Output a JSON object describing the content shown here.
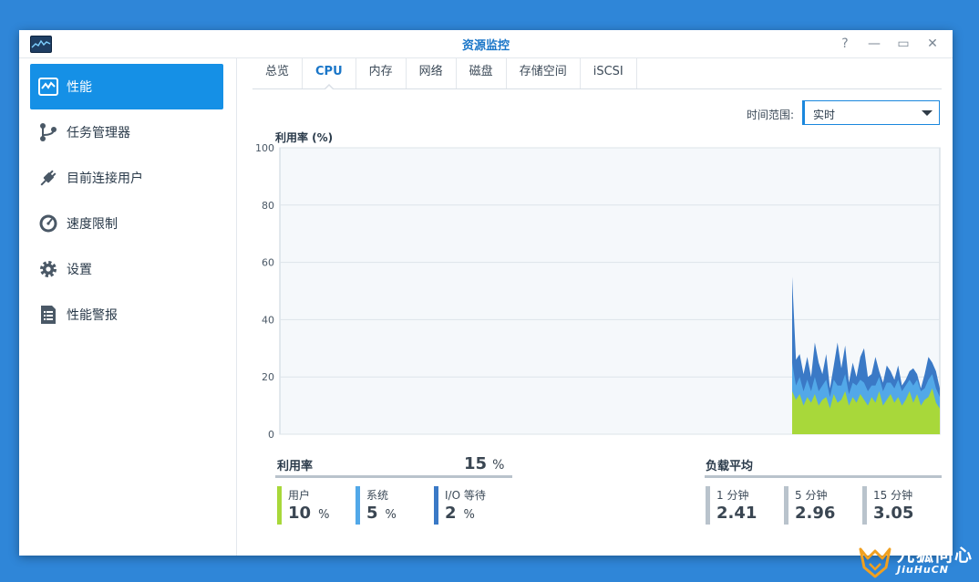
{
  "window": {
    "title": "资源监控"
  },
  "window_controls": [
    "?",
    "—",
    "▭",
    "✕"
  ],
  "sidebar": {
    "items": [
      {
        "label": "性能",
        "icon": "performance-icon",
        "active": true
      },
      {
        "label": "任务管理器",
        "icon": "task-manager-icon"
      },
      {
        "label": "目前连接用户",
        "icon": "plug-icon"
      },
      {
        "label": "速度限制",
        "icon": "speedometer-icon"
      },
      {
        "label": "设置",
        "icon": "gear-icon"
      },
      {
        "label": "性能警报",
        "icon": "report-icon"
      }
    ]
  },
  "tabs": [
    "总览",
    "CPU",
    "内存",
    "网络",
    "磁盘",
    "存储空间",
    "iSCSI"
  ],
  "active_tab": "CPU",
  "time_range": {
    "label": "时间范围:",
    "value": "实时"
  },
  "chart_data": {
    "type": "area",
    "title": "利用率 (%)",
    "ylim": [
      0,
      100
    ],
    "y_ticks": [
      "100",
      "80",
      "60",
      "40",
      "20",
      "0"
    ],
    "grid": true,
    "stacked": true,
    "colors": {
      "user": "#a8d83a",
      "system": "#52a8e8",
      "io": "#3a79c6"
    },
    "series": [
      {
        "name": "用户",
        "values": [
          15,
          12,
          14,
          10,
          13,
          11,
          14,
          10,
          12,
          13,
          9,
          14,
          11,
          12,
          15,
          10,
          13,
          11,
          14,
          12,
          10,
          13,
          11,
          15,
          10,
          12,
          14,
          11,
          13,
          10,
          12,
          15,
          11,
          14,
          10,
          12,
          13,
          16,
          11,
          9
        ]
      },
      {
        "name": "系统",
        "values": [
          10,
          5,
          6,
          5,
          6,
          4,
          6,
          5,
          5,
          6,
          4,
          5,
          6,
          5,
          6,
          4,
          5,
          6,
          5,
          6,
          5,
          4,
          6,
          5,
          5,
          6,
          4,
          5,
          6,
          5,
          5,
          4,
          6,
          5,
          5,
          4,
          6,
          5,
          5,
          4
        ]
      },
      {
        "name": "I/O 等待",
        "values": [
          30,
          9,
          8,
          6,
          8,
          5,
          12,
          10,
          4,
          9,
          3,
          5,
          15,
          6,
          10,
          4,
          7,
          3,
          8,
          12,
          5,
          4,
          10,
          2,
          3,
          6,
          4,
          3,
          5,
          2,
          2,
          3,
          6,
          2,
          1,
          5,
          8,
          4,
          6,
          3
        ]
      }
    ]
  },
  "utilization": {
    "label": "利用率",
    "value": "15",
    "unit": "%"
  },
  "breakdown": [
    {
      "label": "用户",
      "value": "10",
      "unit": "%",
      "color": "#a8d83a"
    },
    {
      "label": "系统",
      "value": "5",
      "unit": "%",
      "color": "#52a8e8"
    },
    {
      "label": "I/O 等待",
      "value": "2",
      "unit": "%",
      "color": "#3a79c6"
    }
  ],
  "load_average": {
    "label": "负载平均",
    "items": [
      {
        "label": "1 分钟",
        "value": "2.41"
      },
      {
        "label": "5 分钟",
        "value": "2.96"
      },
      {
        "label": "15 分钟",
        "value": "3.05"
      }
    ]
  },
  "watermark": {
    "text_cn": "九狐问心",
    "text_en": "JiuHuCN"
  }
}
